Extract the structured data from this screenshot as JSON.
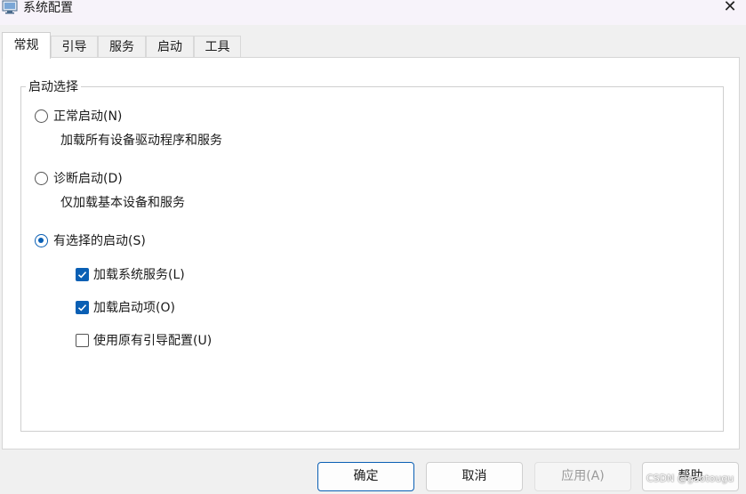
{
  "window": {
    "title": "系统配置",
    "app_icon": "msconfig-icon",
    "close_symbol": "✕"
  },
  "tabs": [
    {
      "label": "常规",
      "active": true
    },
    {
      "label": "引导",
      "active": false
    },
    {
      "label": "服务",
      "active": false
    },
    {
      "label": "启动",
      "active": false
    },
    {
      "label": "工具",
      "active": false
    }
  ],
  "startup_selection": {
    "legend": "启动选择",
    "normal": {
      "label": "正常启动(N)",
      "description": "加载所有设备驱动程序和服务",
      "selected": false
    },
    "diagnostic": {
      "label": "诊断启动(D)",
      "description": "仅加载基本设备和服务",
      "selected": false
    },
    "selective": {
      "label": "有选择的启动(S)",
      "selected": true,
      "options": [
        {
          "label": "加载系统服务(L)",
          "checked": true
        },
        {
          "label": "加载启动项(O)",
          "checked": true
        },
        {
          "label": "使用原有引导配置(U)",
          "checked": false
        }
      ]
    }
  },
  "buttons": {
    "ok": "确定",
    "cancel": "取消",
    "apply": "应用(A)",
    "help": "帮助"
  },
  "watermark": "CSDN @gaotougu",
  "colors": {
    "accent": "#0a5fb4",
    "titlebar": "#f7f3fa",
    "window_bg": "#f0f0f0",
    "panel_bg": "#ffffff"
  }
}
